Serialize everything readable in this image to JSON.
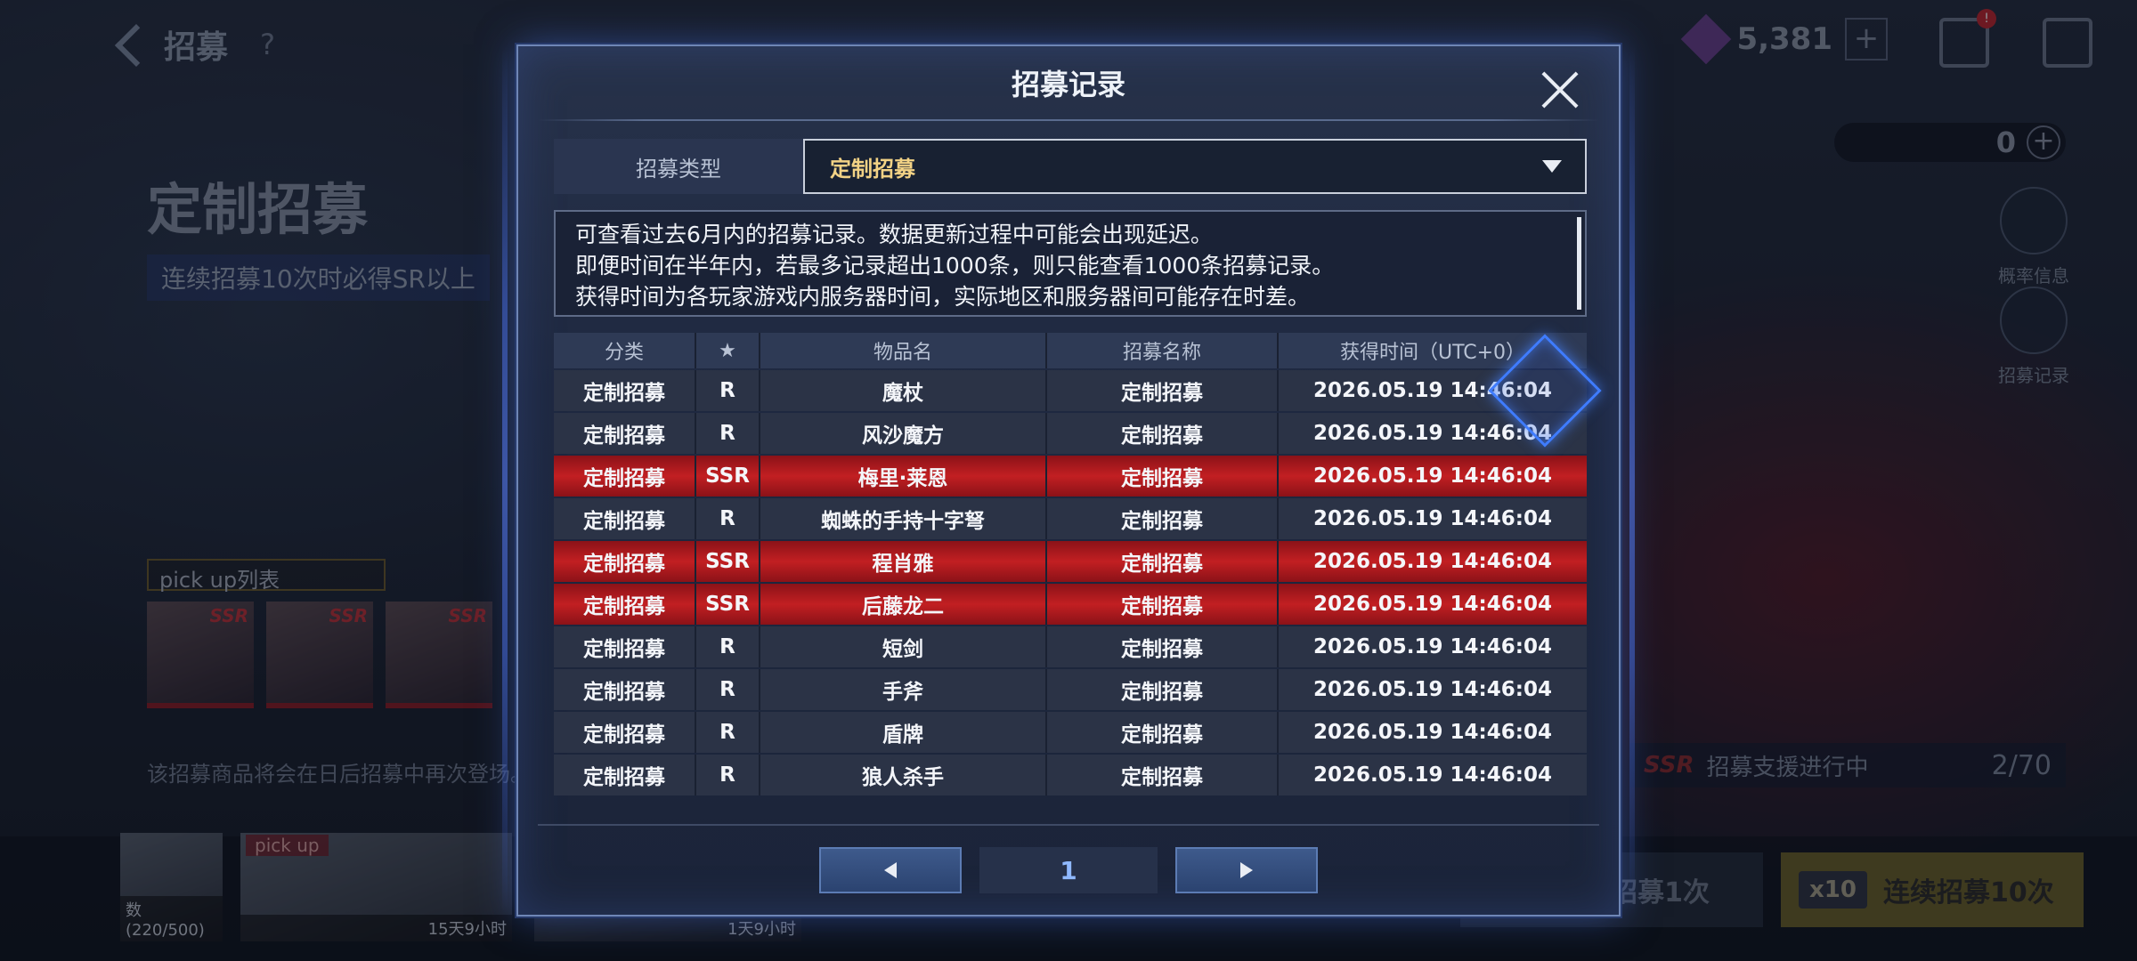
{
  "background": {
    "page_title": "招募",
    "help": "?",
    "banner_title": "定制招募",
    "banner_sub": "连续招募10次时必得SR以上",
    "pickup_label": "pick up列表",
    "pickup_cards": [
      "SSR",
      "SSR",
      "SSR"
    ],
    "bottom_note": "该招募商品将会在日后招募中再次登场。",
    "currency_value": "5,381",
    "currency_plus": "+",
    "ticket_value": "0",
    "ticket_plus": "+",
    "badge": "!",
    "side_buttons": [
      "概率信息",
      "招募记录"
    ],
    "support_ssr": "SSR",
    "support_text": "招募支援进行中",
    "support_count": "2/70",
    "thumb1_caption": "数(220/500)",
    "thumb2_tag": "pick up",
    "thumb2_caption": "15天9小时",
    "thumb3_caption": "1天9小时",
    "pull_one": "招募1次",
    "pull_ten_badge": "x10",
    "pull_ten": "连续招募10次"
  },
  "modal": {
    "title": "招募记录",
    "type_label": "招募类型",
    "type_value": "定制招募",
    "notice_lines": [
      "可查看过去6月内的招募记录。数据更新过程中可能会出现延迟。",
      "即便时间在半年内，若最多记录超出1000条，则只能查看1000条招募记录。",
      "获得时间为各玩家游戏内服务器时间，实际地区和服务器间可能存在时差。"
    ],
    "columns": [
      "分类",
      "★",
      "物品名",
      "招募名称",
      "获得时间（UTC+0）"
    ],
    "rows": [
      {
        "category": "定制招募",
        "rarity": "R",
        "item": "魔杖",
        "recruit": "定制招募",
        "time": "2026.05.19 14:46:04"
      },
      {
        "category": "定制招募",
        "rarity": "R",
        "item": "风沙魔方",
        "recruit": "定制招募",
        "time": "2026.05.19 14:46:04"
      },
      {
        "category": "定制招募",
        "rarity": "SSR",
        "item": "梅里·莱恩",
        "recruit": "定制招募",
        "time": "2026.05.19 14:46:04"
      },
      {
        "category": "定制招募",
        "rarity": "R",
        "item": "蜘蛛的手持十字弩",
        "recruit": "定制招募",
        "time": "2026.05.19 14:46:04"
      },
      {
        "category": "定制招募",
        "rarity": "SSR",
        "item": "程肖雅",
        "recruit": "定制招募",
        "time": "2026.05.19 14:46:04"
      },
      {
        "category": "定制招募",
        "rarity": "SSR",
        "item": "后藤龙二",
        "recruit": "定制招募",
        "time": "2026.05.19 14:46:04"
      },
      {
        "category": "定制招募",
        "rarity": "R",
        "item": "短剑",
        "recruit": "定制招募",
        "time": "2026.05.19 14:46:04"
      },
      {
        "category": "定制招募",
        "rarity": "R",
        "item": "手斧",
        "recruit": "定制招募",
        "time": "2026.05.19 14:46:04"
      },
      {
        "category": "定制招募",
        "rarity": "R",
        "item": "盾牌",
        "recruit": "定制招募",
        "time": "2026.05.19 14:46:04"
      },
      {
        "category": "定制招募",
        "rarity": "R",
        "item": "狼人杀手",
        "recruit": "定制招募",
        "time": "2026.05.19 14:46:04"
      }
    ],
    "page_number": "1",
    "colors": {
      "ssr_row": "#c21f22",
      "selected_value": "#f2d285",
      "page_number": "#8fb8ff"
    }
  }
}
